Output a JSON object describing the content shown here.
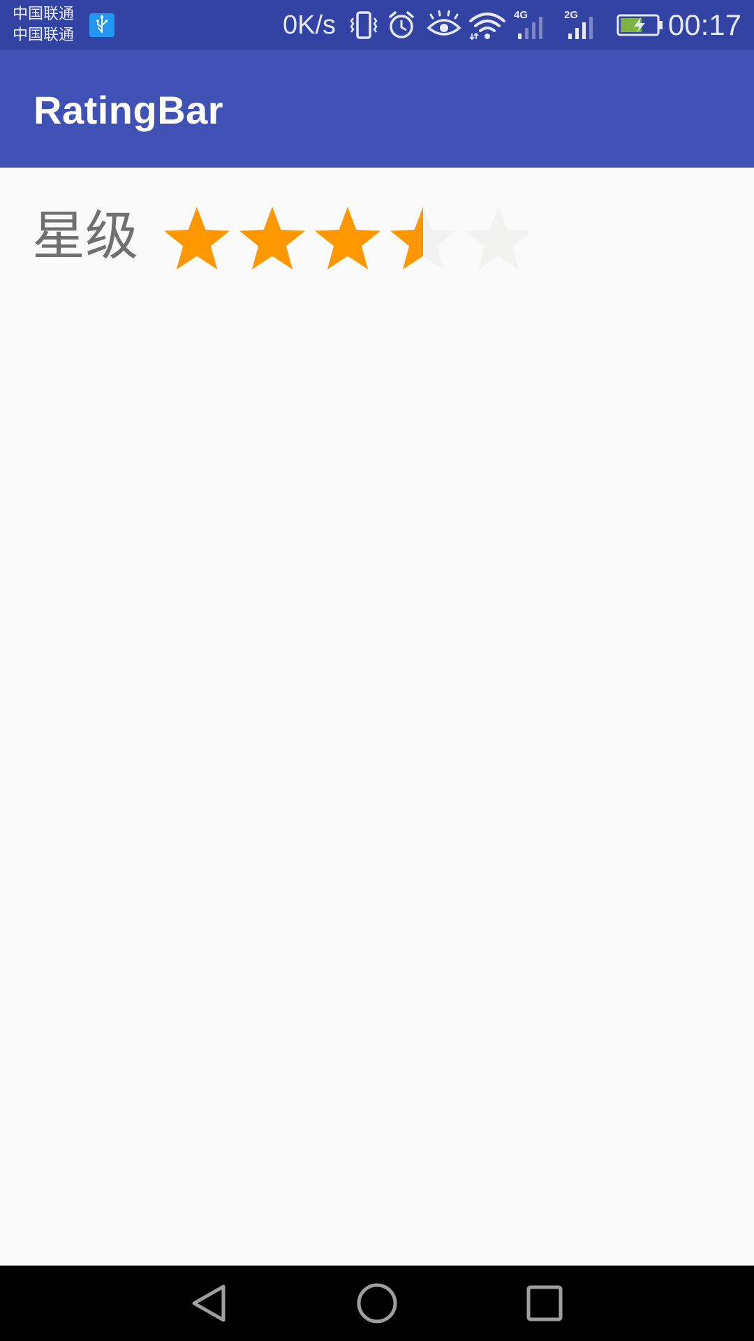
{
  "status_bar": {
    "carrier_1": "中国联通",
    "carrier_2": "中国联通",
    "net_speed": "0K/s",
    "signal_1_type": "4G",
    "signal_2_type": "2G",
    "time": "00:17",
    "icons": [
      "usb-icon",
      "vibrate-icon",
      "alarm-icon",
      "eye-comfort-icon",
      "wifi-icon",
      "signal-4g-icon",
      "signal-2g-icon",
      "battery-charging-icon"
    ]
  },
  "app_bar": {
    "title": "RatingBar"
  },
  "rating": {
    "label": "星级",
    "value": 3.5,
    "max": 5,
    "fill_color": "#FF9800",
    "empty_color": "#F2F2F0"
  },
  "nav_bar": {
    "icons": [
      "back-icon",
      "home-icon",
      "recents-icon"
    ]
  },
  "colors": {
    "status_bar": "#3243A4",
    "app_bar": "#3F51B5",
    "background": "#FAFAFA",
    "nav_bar": "#000000"
  }
}
